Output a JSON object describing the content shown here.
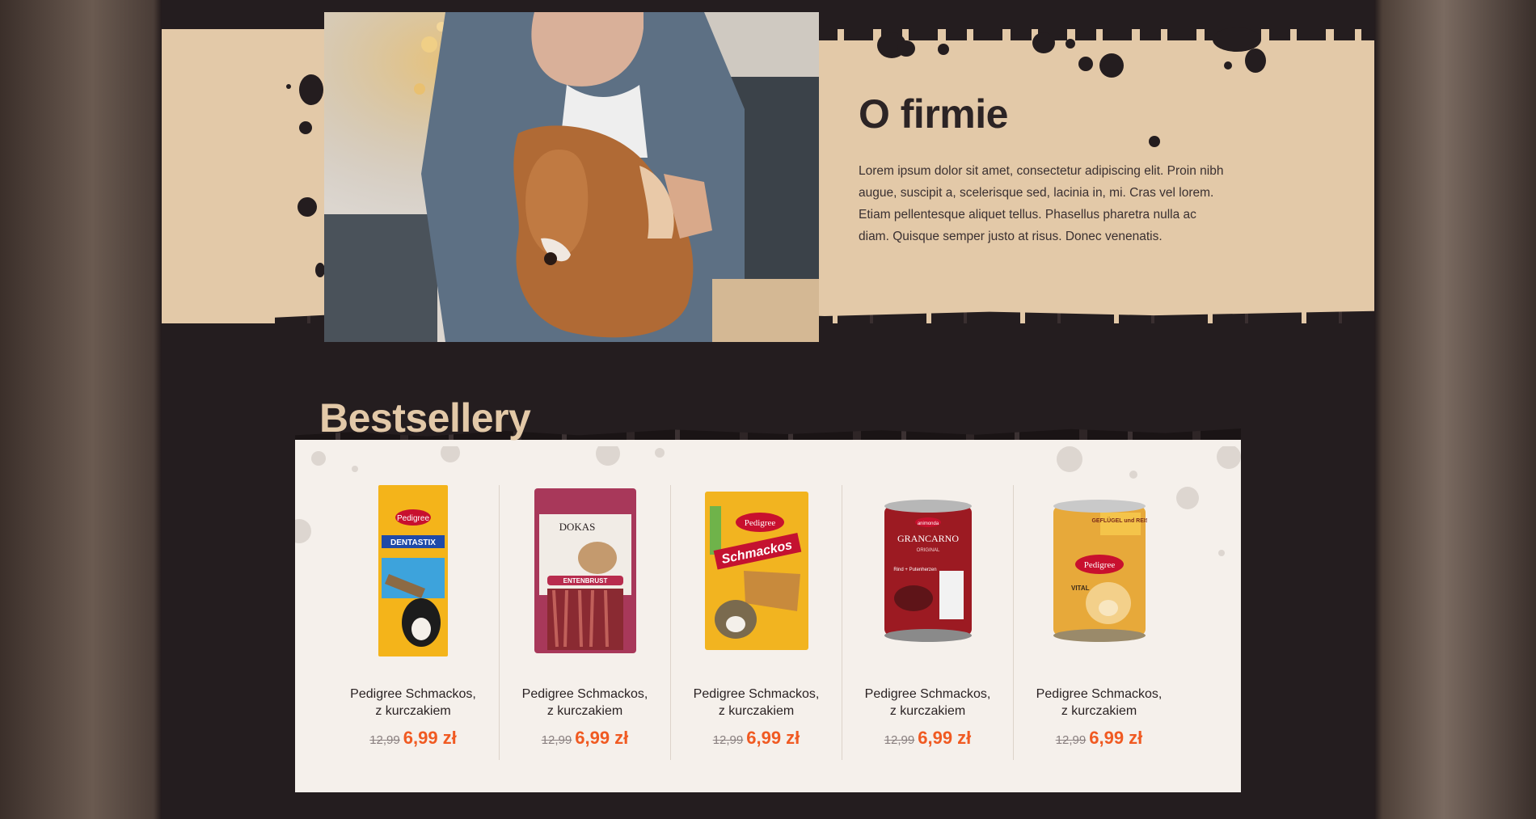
{
  "about": {
    "title": "O firmie",
    "text": "Lorem ipsum dolor sit amet, consectetur adipiscing elit. Proin nibh augue, suscipit a, scelerisque sed, lacinia in, mi. Cras vel lorem. Etiam pellentesque aliquet tellus. Phasellus pharetra nulla ac diam. Quisque semper justo at risus. Donec venenatis."
  },
  "bestsellers": {
    "title": "Bestsellery",
    "products": [
      {
        "name_line1": "Pedigree Schmackos,",
        "name_line2": "z kurczakiem",
        "old_price": "12,99",
        "price": "6,99 zł",
        "image": "pedigree-dentastix-package"
      },
      {
        "name_line1": "Pedigree Schmackos,",
        "name_line2": "z kurczakiem",
        "old_price": "12,99",
        "price": "6,99 zł",
        "image": "dokas-entenbrust-package"
      },
      {
        "name_line1": "Pedigree Schmackos,",
        "name_line2": "z kurczakiem",
        "old_price": "12,99",
        "price": "6,99 zł",
        "image": "pedigree-schmackos-package"
      },
      {
        "name_line1": "Pedigree Schmackos,",
        "name_line2": "z kurczakiem",
        "old_price": "12,99",
        "price": "6,99 zł",
        "image": "grancarno-can"
      },
      {
        "name_line1": "Pedigree Schmackos,",
        "name_line2": "z kurczakiem",
        "old_price": "12,99",
        "price": "6,99 zł",
        "image": "pedigree-vital-can"
      }
    ]
  },
  "packaging_text": {
    "p1_brand": "Pedigree",
    "p1_name": "DENTASTIX",
    "p2_brand": "DOKAS",
    "p2_name": "ENTENBRUST",
    "p3_brand": "Pedigree",
    "p3_name": "Schmackos",
    "p4_brand": "animonda",
    "p4_name": "GRANCARNO",
    "p4_sub": "ORIGINAL",
    "p4_flavor": "Rind + Putenherzen",
    "p5_name": "GEFLÜGEL und REIS",
    "p5_brand": "Pedigree",
    "p5_line": "VITAL"
  },
  "colors": {
    "background": "#241d1f",
    "tan": "#e3c9a8",
    "panel": "#f5f0eb",
    "price": "#f05a22"
  }
}
